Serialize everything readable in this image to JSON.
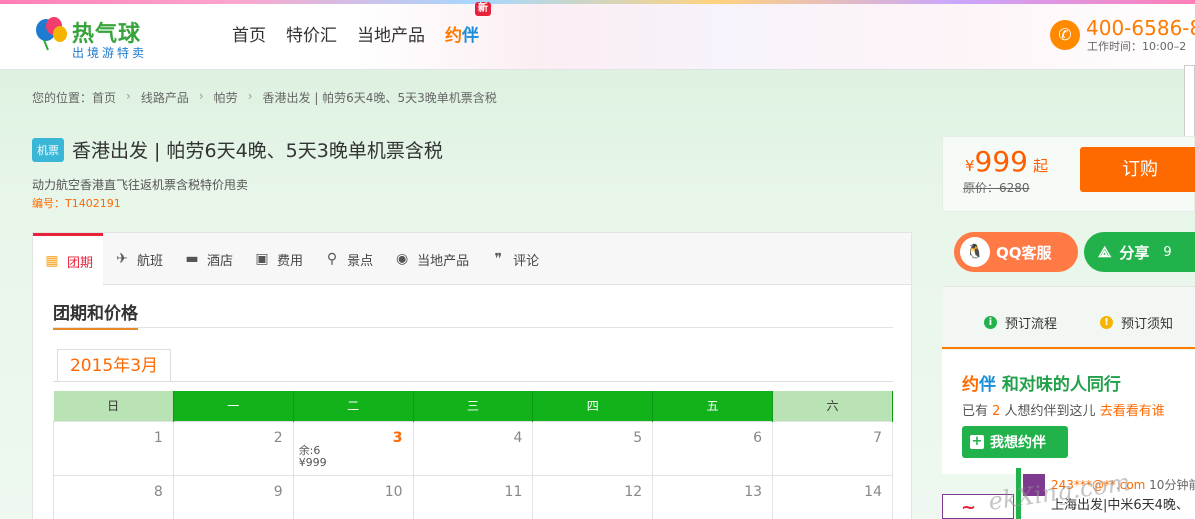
{
  "header": {
    "logo_name": "热气球",
    "logo_slogan": "出境游特卖",
    "nav": [
      "首页",
      "特价汇",
      "当地产品",
      "约伴"
    ],
    "nav_special_part1": "约",
    "nav_special_part2": "伴",
    "new_badge": "新",
    "phone": "400-6586-8",
    "work_time": "工作时间：10:00–2"
  },
  "breadcrumb": {
    "label": "您的位置：",
    "items": [
      "首页",
      "线路产品",
      "帕劳",
      "香港出发 | 帕劳6天4晚、5天3晚单机票含税"
    ],
    "sep": "›"
  },
  "product": {
    "tag": "机票",
    "title": "香港出发 | 帕劳6天4晚、5天3晚单机票含税",
    "subtitle": "动力航空香港直飞往返机票含税特价甩卖",
    "code": "编号：T1402191"
  },
  "price": {
    "currency": "¥",
    "value": "999",
    "suffix": "起",
    "original": "原价：6280",
    "book_label": "订购"
  },
  "tabs": [
    {
      "label": "团期",
      "icon": "calendar-icon"
    },
    {
      "label": "航班",
      "icon": "plane-icon"
    },
    {
      "label": "酒店",
      "icon": "bed-icon"
    },
    {
      "label": "费用",
      "icon": "wallet-icon"
    },
    {
      "label": "景点",
      "icon": "location-icon"
    },
    {
      "label": "当地产品",
      "icon": "pin-icon"
    },
    {
      "label": "评论",
      "icon": "comment-icon"
    }
  ],
  "section_title": "团期和价格",
  "month_tab": "2015年3月",
  "calendar": {
    "weekdays": [
      "日",
      "一",
      "二",
      "三",
      "四",
      "五",
      "六"
    ],
    "rows": [
      [
        "1",
        "2",
        "3",
        "4",
        "5",
        "6",
        "7"
      ],
      [
        "8",
        "9",
        "10",
        "11",
        "12",
        "13",
        "14"
      ]
    ],
    "highlight_day": "3",
    "remaining": "余:6",
    "day_price": "¥999"
  },
  "sidebar": {
    "qq_label": "QQ客服",
    "share_label": "分享",
    "share_count": "9",
    "process_label": "预订流程",
    "notice_label": "预订须知",
    "yueban_part1": "约",
    "yueban_part2": "伴",
    "yueban_slogan": " 和对味的人同行",
    "yueban_info_prefix": "已有 ",
    "yueban_count": "2",
    "yueban_info_mid": " 人想约伴到这儿 ",
    "yueban_link": "去看看有谁",
    "yueban_button": "我想约伴",
    "feed_user": "243***@**.com",
    "feed_ago": " 10分钟前",
    "feed_text": "上海出发|中米6天4晚、",
    "watermark": "ekXing.com"
  },
  "colors": {
    "accent": "#ff6a00",
    "green": "#12b21b",
    "red": "#e8223a"
  }
}
